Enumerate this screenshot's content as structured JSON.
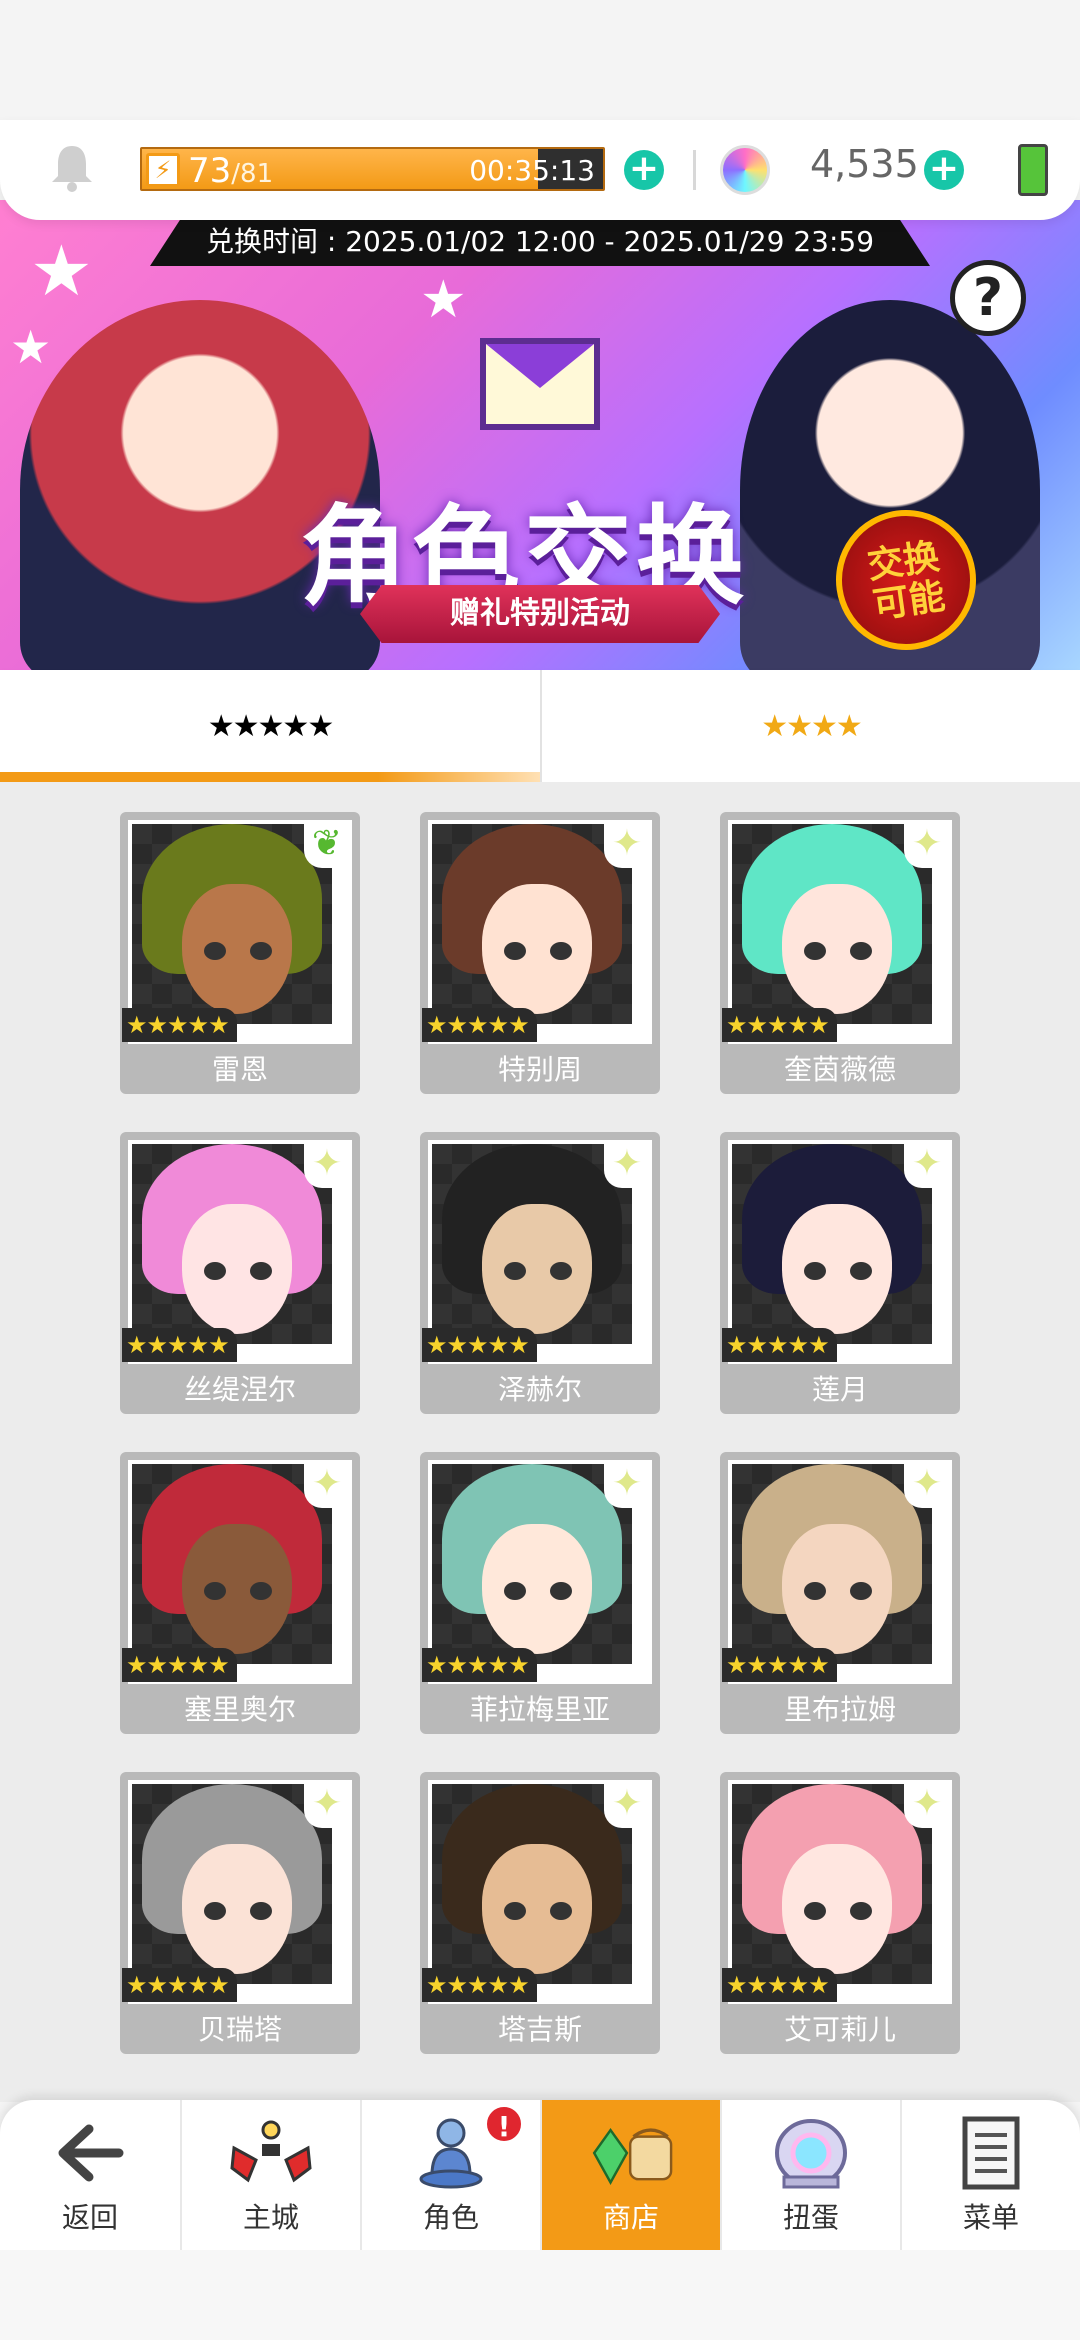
{
  "topbar": {
    "stamina_current": "73",
    "stamina_max": "/81",
    "stamina_fraction": 0.86,
    "timer": "00:35:13",
    "gems": "4,535"
  },
  "banner": {
    "date_range": "兑换时间 : 2025.01/02 12:00 - 2025.01/29 23:59",
    "title": "角色交换",
    "subtitle": "赠礼特别活动",
    "badge_line1": "交换",
    "badge_line2": "可能",
    "help": "?"
  },
  "tabs": [
    {
      "label": "★★★★★",
      "rarity": 5,
      "active": true
    },
    {
      "label": "★★★★",
      "rarity": 4,
      "active": false
    }
  ],
  "characters": [
    {
      "name": "雷恩",
      "stars": "★★★★★",
      "hair": "#6a7a1c",
      "skin": "#b9774a",
      "corner": "leaf"
    },
    {
      "name": "特别周",
      "stars": "★★★★★",
      "hair": "#6b3b2a",
      "skin": "#ffe2d2",
      "corner": "sparkle"
    },
    {
      "name": "奎茵薇德",
      "stars": "★★★★★",
      "hair": "#5fe6c6",
      "skin": "#ffe5dc",
      "corner": "sparkle"
    },
    {
      "name": "丝缇涅尔",
      "stars": "★★★★★",
      "hair": "#f08ad8",
      "skin": "#ffe4e4",
      "corner": "sparkle"
    },
    {
      "name": "泽赫尔",
      "stars": "★★★★★",
      "hair": "#222222",
      "skin": "#e8c9a8",
      "corner": "sparkle"
    },
    {
      "name": "莲月",
      "stars": "★★★★★",
      "hair": "#1c1c3a",
      "skin": "#ffe6de",
      "corner": "sparkle"
    },
    {
      "name": "塞里奥尔",
      "stars": "★★★★★",
      "hair": "#c02a3a",
      "skin": "#8a5a3a",
      "corner": "sparkle"
    },
    {
      "name": "菲拉梅里亚",
      "stars": "★★★★★",
      "hair": "#7fc4b4",
      "skin": "#ffe8da",
      "corner": "sparkle"
    },
    {
      "name": "里布拉姆",
      "stars": "★★★★★",
      "hair": "#c9b08a",
      "skin": "#f4d6c0",
      "corner": "sparkle"
    },
    {
      "name": "贝瑞塔",
      "stars": "★★★★★",
      "hair": "#9a9a9a",
      "skin": "#fbe2d6",
      "corner": "sparkle"
    },
    {
      "name": "塔吉斯",
      "stars": "★★★★★",
      "hair": "#3a2a1c",
      "skin": "#e6bc94",
      "corner": "sparkle"
    },
    {
      "name": "艾可莉儿",
      "stars": "★★★★★",
      "hair": "#f4a0b0",
      "skin": "#ffe6e0",
      "corner": "sparkle"
    }
  ],
  "nav": [
    {
      "label": "返回",
      "icon": "back-arrow-icon",
      "glyph": "←"
    },
    {
      "label": "主城",
      "icon": "castle-icon",
      "glyph": "♜"
    },
    {
      "label": "角色",
      "icon": "character-icon",
      "glyph": "♟",
      "notification": "!"
    },
    {
      "label": "商店",
      "icon": "shop-icon",
      "glyph": "⛁",
      "active": true
    },
    {
      "label": "扭蛋",
      "icon": "gacha-icon",
      "glyph": "◎"
    },
    {
      "label": "菜单",
      "icon": "menu-list-icon",
      "glyph": "☰"
    }
  ],
  "colors": {
    "accent": "#f39a16",
    "plus": "#17c6a8",
    "card_bg": "#b9b9b9",
    "notification": "#e0262f"
  }
}
